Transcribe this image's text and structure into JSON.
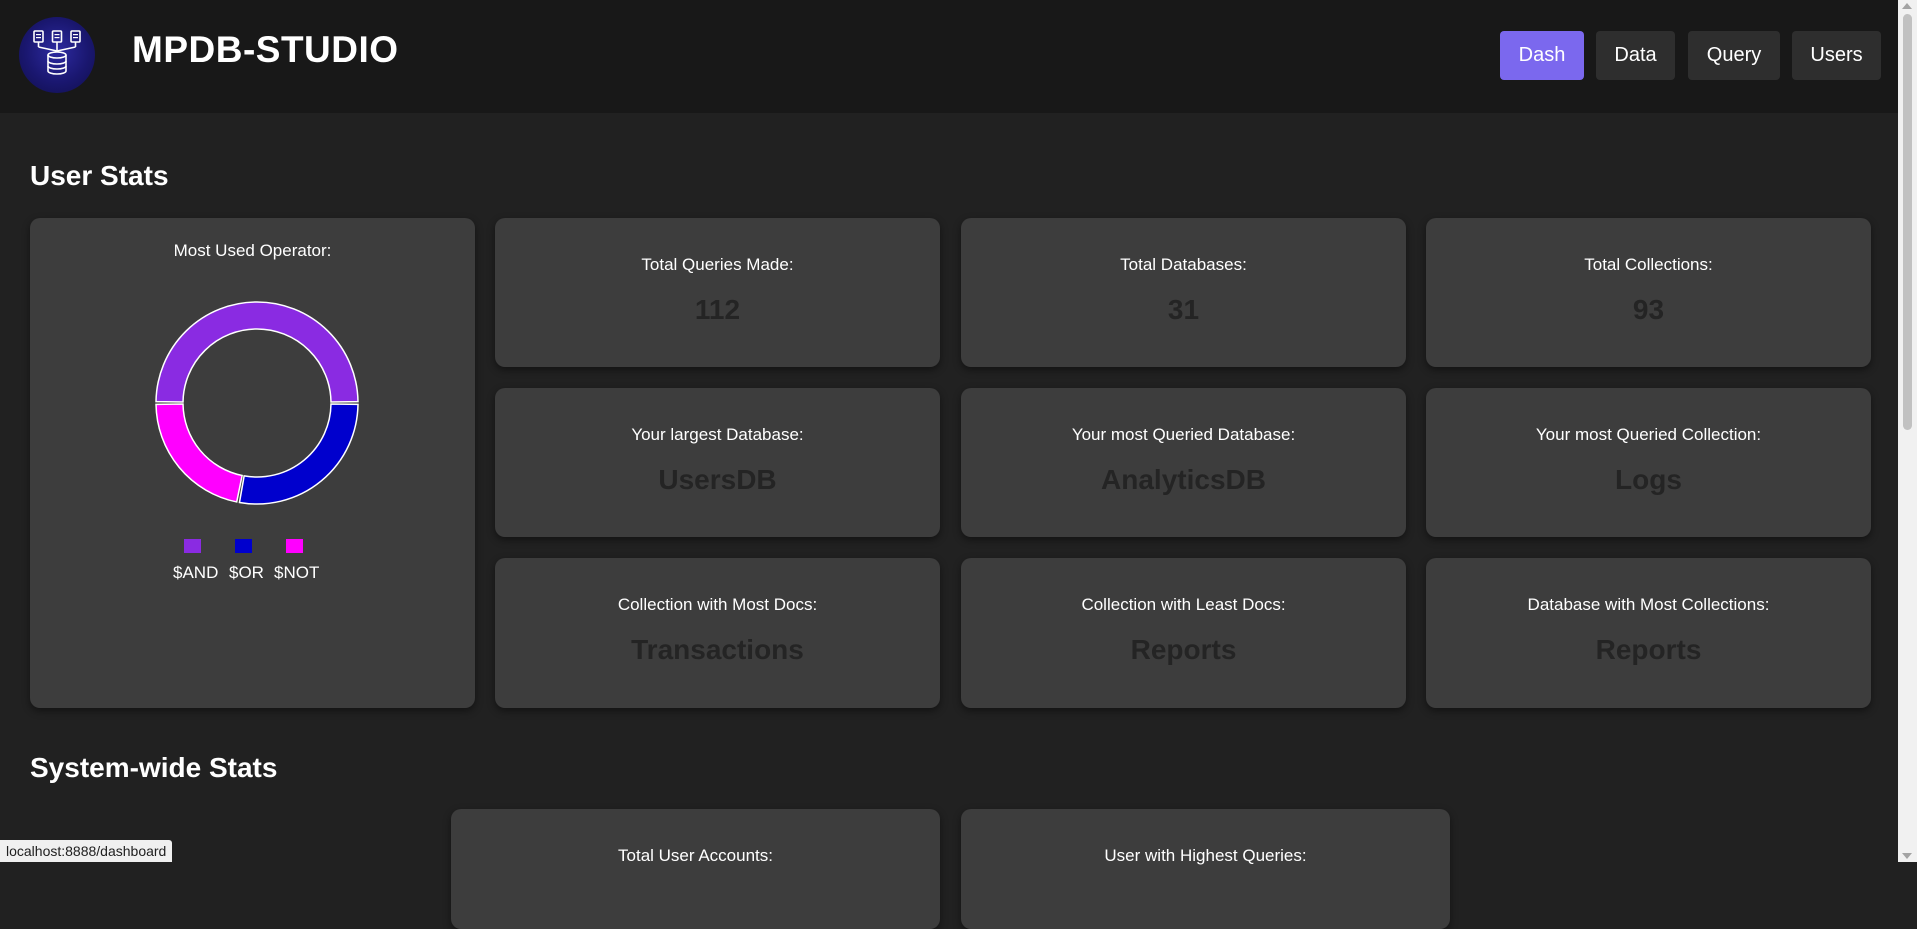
{
  "app": {
    "title": "MPDB-STUDIO"
  },
  "nav": {
    "items": [
      {
        "label": "Dash",
        "active": true
      },
      {
        "label": "Data",
        "active": false
      },
      {
        "label": "Query",
        "active": false
      },
      {
        "label": "Users",
        "active": false
      }
    ]
  },
  "user_stats": {
    "title": "User Stats",
    "operator_card": {
      "label": "Most Used Operator:",
      "legend": [
        "$AND",
        "$OR",
        "$NOT"
      ]
    },
    "cards": [
      {
        "label": "Total Queries Made:",
        "value": "112"
      },
      {
        "label": "Total Databases:",
        "value": "31"
      },
      {
        "label": "Total Collections:",
        "value": "93"
      },
      {
        "label": "Your largest Database:",
        "value": "UsersDB"
      },
      {
        "label": "Your most Queried Database:",
        "value": "AnalyticsDB"
      },
      {
        "label": "Your most Queried Collection:",
        "value": "Logs"
      },
      {
        "label": "Collection with Most Docs:",
        "value": "Transactions"
      },
      {
        "label": "Collection with Least Docs:",
        "value": "Reports"
      },
      {
        "label": "Database with Most Collections:",
        "value": "Reports"
      }
    ]
  },
  "system_stats": {
    "title": "System-wide Stats",
    "cards": [
      {
        "label": "Total User Accounts:"
      },
      {
        "label": "User with Highest Queries:"
      }
    ]
  },
  "chart_data": {
    "type": "pie",
    "style": "donut",
    "categories": [
      "$AND",
      "$OR",
      "$NOT"
    ],
    "values": [
      50,
      28,
      22
    ],
    "colors": [
      "#8a2be2",
      "#0000cd",
      "#ff00ff"
    ]
  },
  "status_bar": {
    "url": "localhost:8888/dashboard"
  }
}
